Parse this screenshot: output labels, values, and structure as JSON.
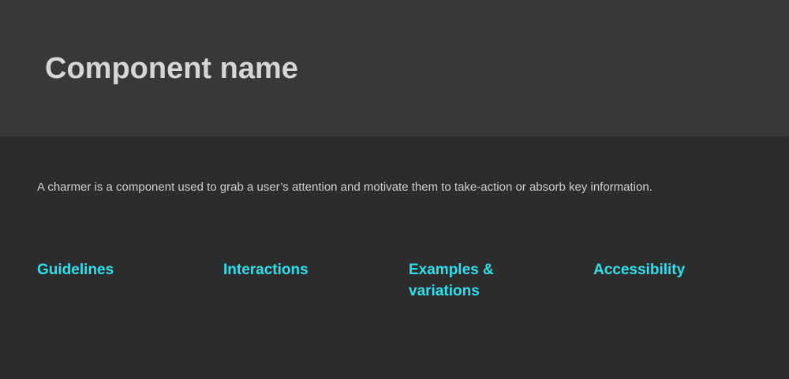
{
  "header": {
    "title": "Component name"
  },
  "main": {
    "description": "A charmer is a component used to grab a user’s attention and motivate them to take-action or absorb key information.",
    "links": [
      {
        "label": "Guidelines"
      },
      {
        "label": "Interactions"
      },
      {
        "label": "Examples & variations"
      },
      {
        "label": "Accessibility"
      }
    ]
  },
  "colors": {
    "header_bg": "#383838",
    "page_bg": "#2c2c2c",
    "title": "#d6d6d6",
    "body_text": "#cfcfcf",
    "link": "#2ee0ed"
  }
}
